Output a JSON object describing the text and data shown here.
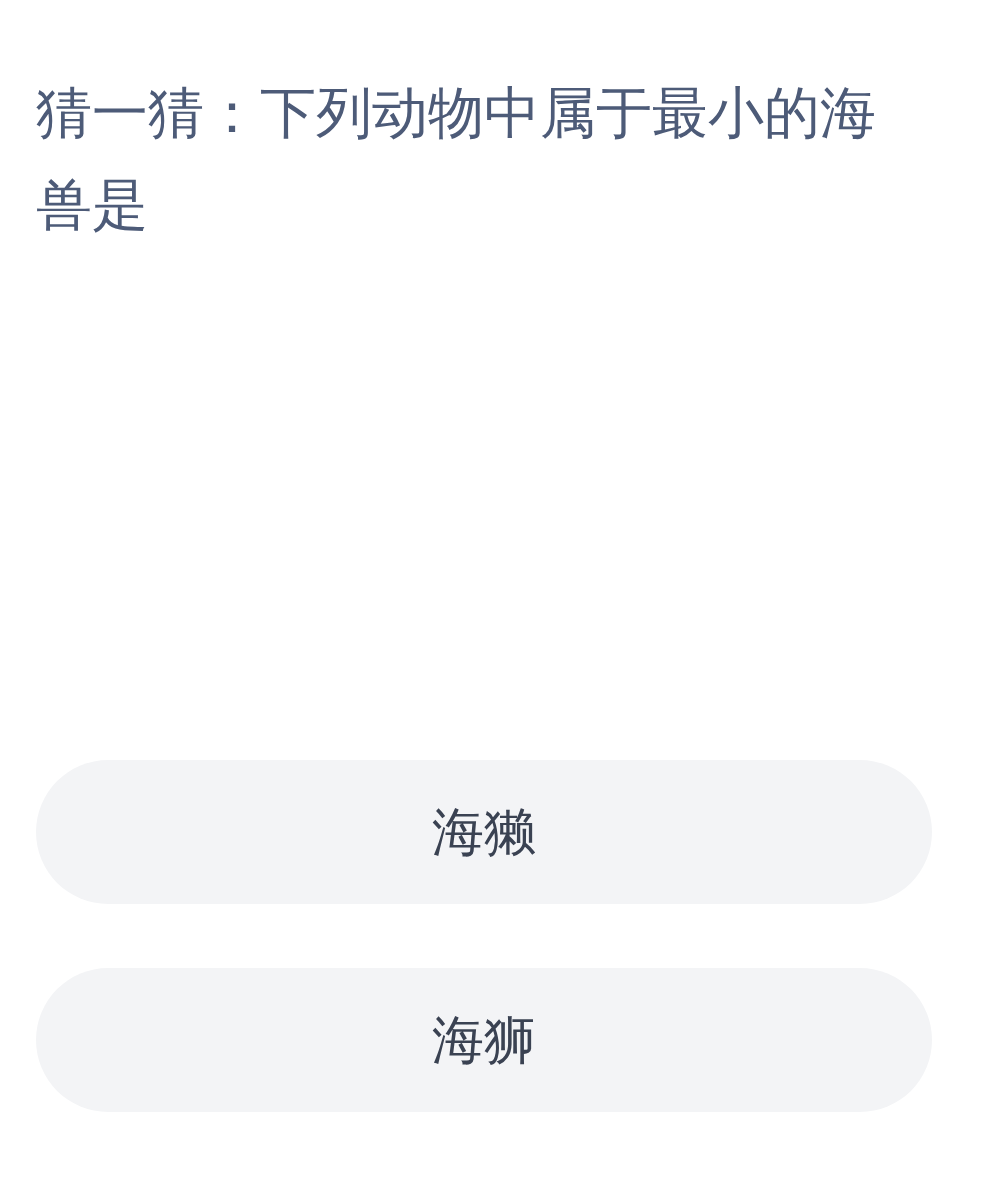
{
  "question": "猜一猜：下列动物中属于最小的海兽是",
  "options": [
    {
      "label": "海獭"
    },
    {
      "label": "海狮"
    }
  ]
}
